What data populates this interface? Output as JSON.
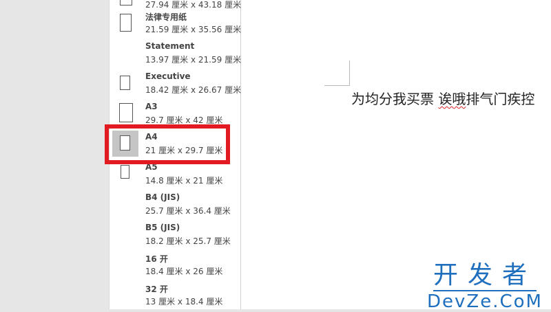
{
  "paper_sizes": [
    {
      "name": "",
      "dims": "27.94 厘米 x 43.18 厘米",
      "thumb": "portrait"
    },
    {
      "name": "法律专用纸",
      "dims": "21.59 厘米 x 35.56 厘米",
      "thumb": "portrait"
    },
    {
      "name": "Statement",
      "dims": "13.97 厘米 x 21.59 厘米",
      "thumb": "none"
    },
    {
      "name": "Executive",
      "dims": "18.42 厘米 x 26.67 厘米",
      "thumb": "portrait"
    },
    {
      "name": "A3",
      "dims": "29.7 厘米 x 42 厘米",
      "thumb": "portrait"
    },
    {
      "name": "A4",
      "dims": "21 厘米 x 29.7 厘米",
      "thumb": "portrait",
      "selected": true
    },
    {
      "name": "A5",
      "dims": "14.8 厘米 x 21 厘米",
      "thumb": "portrait"
    },
    {
      "name": "B4 (JIS)",
      "dims": "25.7 厘米 x 36.4 厘米",
      "thumb": "none"
    },
    {
      "name": "B5 (JIS)",
      "dims": "18.2 厘米 x 25.7 厘米",
      "thumb": "none"
    },
    {
      "name": "16 开",
      "dims": "18.4 厘米 x 26 厘米",
      "thumb": "none"
    },
    {
      "name": "32 开",
      "dims": "13 厘米 x 18.4 厘米",
      "thumb": "none"
    }
  ],
  "document": {
    "text_main": "为均分我买票  ",
    "text_squiggle": "诶哦",
    "text_rest": "排气门疾控"
  },
  "watermark": {
    "cn": "开发者",
    "en": "DevZe.CoM"
  },
  "colors": {
    "highlight": "#e21b23",
    "watermark": "#1f6fbf",
    "selected_thumb_bg": "#c5c5c5"
  }
}
